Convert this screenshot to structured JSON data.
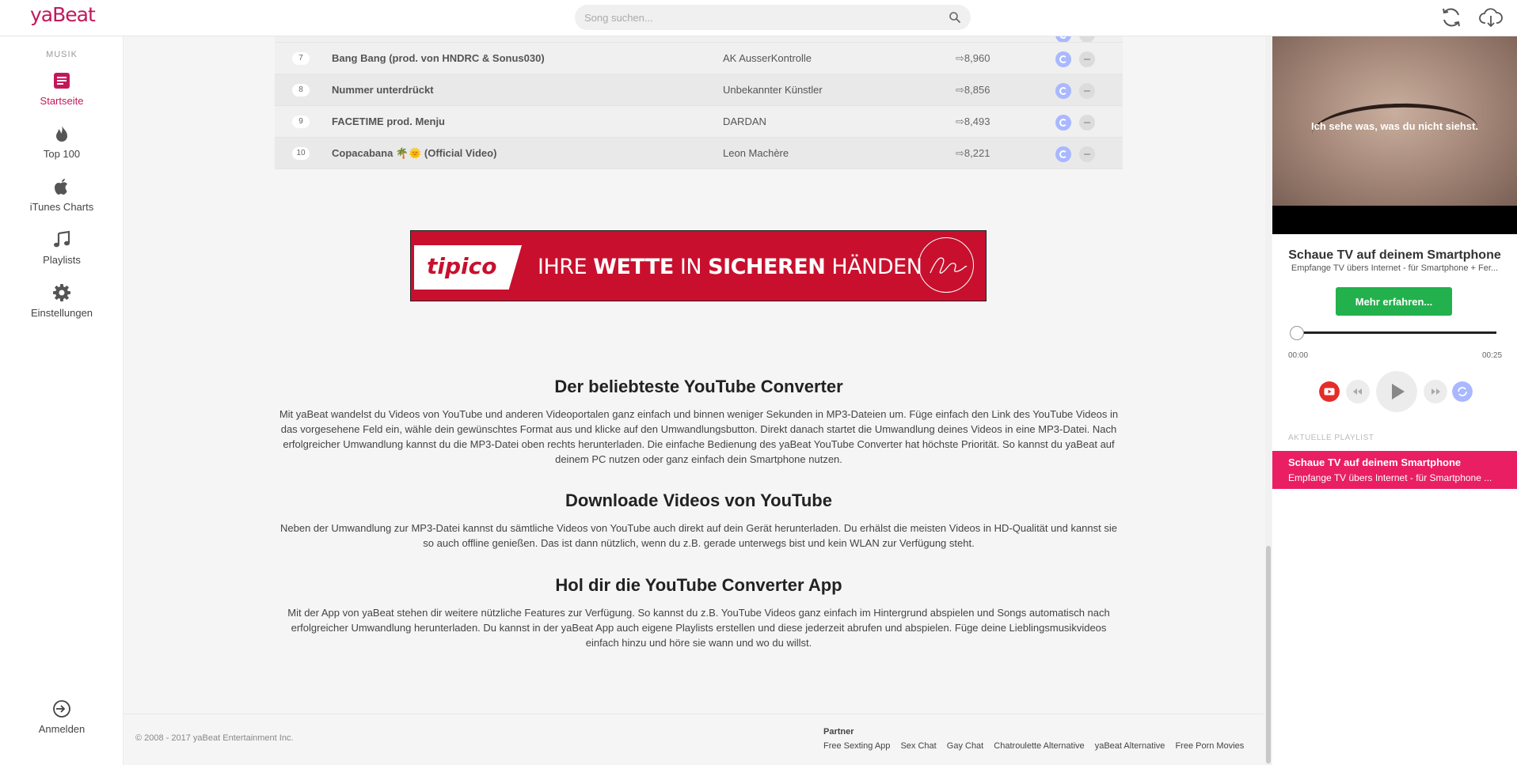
{
  "header": {
    "logo": "yaBeat",
    "search_placeholder": "Song suchen...",
    "icons": [
      "search-icon",
      "sync-icon",
      "cloud-download-icon"
    ]
  },
  "nav": {
    "heading": "MUSIK",
    "items": [
      {
        "label": "Startseite",
        "icon": "list-icon",
        "active": true
      },
      {
        "label": "Top 100",
        "icon": "flame-icon"
      },
      {
        "label": "iTunes Charts",
        "icon": "apple-icon"
      },
      {
        "label": "Playlists",
        "icon": "music-note-icon"
      },
      {
        "label": "Einstellungen",
        "icon": "gear-icon"
      }
    ],
    "login_label": "Anmelden"
  },
  "tracks": [
    {
      "num": "7",
      "title": "Bang Bang (prod. von HNDRC & Sonus030)",
      "artist": "AK AusserKontrolle",
      "plays": "8,960"
    },
    {
      "num": "8",
      "title": "Nummer unterdrückt",
      "artist": "Unbekannter Künstler",
      "plays": "8,856"
    },
    {
      "num": "9",
      "title": "FACETIME prod. Menju",
      "artist": "DARDAN",
      "plays": "8,493"
    },
    {
      "num": "10",
      "title": "Copacabana 🌴🌞 (Official Video)",
      "artist": "Leon Machère",
      "plays": "8,221"
    }
  ],
  "ad": {
    "brand": "tipico",
    "slogan_1": "IHRE ",
    "slogan_2": "WETTE",
    "slogan_3": " IN ",
    "slogan_4": "SICHEREN",
    "slogan_5": " HÄNDEN"
  },
  "articles": [
    {
      "title": "Der beliebteste YouTube Converter",
      "body": "Mit yaBeat wandelst du Videos von YouTube und anderen Videoportalen ganz einfach und binnen weniger Sekunden in MP3-Dateien um. Füge einfach den Link des YouTube Videos in das vorgesehene Feld ein, wähle dein gewünschtes Format aus und klicke auf den Umwandlungsbutton. Direkt danach startet die Umwandlung deines Videos in eine MP3-Datei. Nach erfolgreicher Umwandlung kannst du die MP3-Datei oben rechts herunterladen. Die einfache Bedienung des yaBeat YouTube Converter hat höchste Priorität. So kannst du yaBeat auf deinem PC nutzen oder ganz einfach dein Smartphone nutzen."
    },
    {
      "title": "Downloade Videos von YouTube",
      "body": "Neben der Umwandlung zur MP3-Datei kannst du sämtliche Videos von YouTube auch direkt auf dein Gerät herunterladen. Du erhälst die meisten Videos in HD-Qualität und kannst sie so auch offline genießen. Das ist dann nützlich, wenn du z.B. gerade unterwegs bist und kein WLAN zur Verfügung steht."
    },
    {
      "title": "Hol dir die YouTube Converter App",
      "body": "Mit der App von yaBeat stehen dir weitere nützliche Features zur Verfügung. So kannst du z.B. YouTube Videos ganz einfach im Hintergrund abspielen und Songs automatisch nach erfolgreicher Umwandlung herunterladen. Du kannst in der yaBeat App auch eigene Playlists erstellen und diese jederzeit abrufen und abspielen. Füge deine Lieblingsmusikvideos einfach hinzu und höre sie wann und wo du willst."
    }
  ],
  "footer": {
    "copyright": "© 2008 - 2017 yaBeat Entertainment Inc.",
    "partner_heading": "Partner",
    "partner_links": [
      "Free Sexting App",
      "Sex Chat",
      "Gay Chat",
      "Chatroulette Alternative",
      "yaBeat Alternative",
      "Free Porn Movies"
    ]
  },
  "player": {
    "video_caption": "Ich sehe was, was du nicht siehst.",
    "promo_title": "Schaue TV auf deinem Smartphone",
    "promo_subtitle": "Empfange TV übers Internet - für Smartphone + Fer...",
    "cta_label": "Mehr erfahren...",
    "progress": 0,
    "time_current": "00:00",
    "time_total": "00:25",
    "playlist_heading": "AKTUELLE PLAYLIST",
    "playlist_item_title": "Schaue TV auf deinem Smartphone",
    "playlist_item_subtitle": "Empfange TV übers Internet - für Smartphone ..."
  },
  "colors": {
    "brand": "#c2185b",
    "playlist_active": "#e91e63",
    "cta": "#22b14c",
    "convert_button": "#a9b8ff",
    "ad_red": "#c8102e"
  }
}
